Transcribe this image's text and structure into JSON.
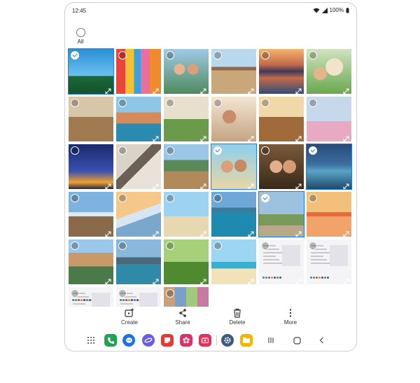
{
  "status": {
    "time": "12:45",
    "battery": "100%"
  },
  "select_all": {
    "label": "All"
  },
  "photos": [
    {
      "sel": true,
      "expand": true,
      "scene": "palm-trees-blue-sky"
    },
    {
      "sel": false,
      "expand": true,
      "scene": "colorful-harbor-houses"
    },
    {
      "sel": false,
      "expand": true,
      "scene": "friends-selfie"
    },
    {
      "sel": false,
      "expand": true,
      "scene": "balcony-view"
    },
    {
      "sel": false,
      "expand": true,
      "scene": "mountain-lake-reflection"
    },
    {
      "sel": false,
      "expand": true,
      "scene": "girl-with-dog"
    },
    {
      "sel": false,
      "expand": false,
      "scene": "group-dinner"
    },
    {
      "sel": false,
      "expand": true,
      "scene": "coastal-village"
    },
    {
      "sel": false,
      "expand": true,
      "scene": "picnic-friends"
    },
    {
      "sel": false,
      "expand": true,
      "scene": "couple-drinks"
    },
    {
      "sel": false,
      "expand": true,
      "scene": "outdoor-dinner"
    },
    {
      "sel": false,
      "expand": true,
      "scene": "japanese-castle"
    },
    {
      "sel": false,
      "expand": true,
      "scene": "eiffel-tower-night"
    },
    {
      "sel": false,
      "expand": true,
      "scene": "rocky-river"
    },
    {
      "sel": false,
      "expand": true,
      "scene": "family-mountain-deck"
    },
    {
      "sel": true,
      "expand": true,
      "scene": "beach-selfie"
    },
    {
      "sel": false,
      "expand": true,
      "scene": "two-girls-selfie"
    },
    {
      "sel": true,
      "expand": true,
      "scene": "kayak-sunset"
    },
    {
      "sel": false,
      "expand": true,
      "scene": "mountain-road"
    },
    {
      "sel": false,
      "expand": true,
      "scene": "airplane-wing"
    },
    {
      "sel": false,
      "expand": true,
      "scene": "father-child-beach"
    },
    {
      "sel": false,
      "expand": true,
      "scene": "kayaks-lake"
    },
    {
      "sel": true,
      "expand": true,
      "scene": "friends-bikes"
    },
    {
      "sel": false,
      "expand": true,
      "scene": "torii-gate-sea"
    },
    {
      "sel": false,
      "expand": true,
      "scene": "cliff-town"
    },
    {
      "sel": false,
      "expand": true,
      "scene": "lake-rocks"
    },
    {
      "sel": false,
      "expand": true,
      "scene": "grass-hammock"
    },
    {
      "sel": false,
      "expand": true,
      "scene": "beach-umbrellas"
    },
    {
      "sel": false,
      "expand": true,
      "scene": "screenshot-settings"
    },
    {
      "sel": false,
      "expand": true,
      "scene": "screenshot-settings-2"
    },
    {
      "sel": false,
      "expand": false,
      "scene": "screenshot-app"
    },
    {
      "sel": false,
      "expand": false,
      "scene": "screenshot-app-2"
    },
    {
      "sel": false,
      "expand": false,
      "scene": "screenshot-gallery"
    }
  ],
  "actions": [
    {
      "label": "Create",
      "icon": "create-icon"
    },
    {
      "label": "Share",
      "icon": "share-icon"
    },
    {
      "label": "Delete",
      "icon": "trash-icon"
    },
    {
      "label": "More",
      "icon": "more-vertical-icon"
    }
  ],
  "navbar": {
    "apps": [
      {
        "name": "apps-grid-icon"
      },
      {
        "name": "phone-app-icon",
        "color": "#1fa355"
      },
      {
        "name": "messages-app-icon",
        "color": "#1f6fe5"
      },
      {
        "name": "internet-app-icon",
        "color": "#6b5ce7"
      },
      {
        "name": "notes-app-icon",
        "color": "#e53935"
      },
      {
        "name": "gallery-app-icon",
        "color": "#e0306b"
      },
      {
        "name": "screen-recorder-app-icon",
        "color": "#e5305a"
      },
      {
        "name": "settings-app-icon",
        "color": "#3d5a80"
      },
      {
        "name": "my-files-app-icon",
        "color": "#f5b400"
      }
    ],
    "buttons": [
      "recents-icon",
      "home-icon",
      "back-icon"
    ]
  },
  "colors": {
    "accent": "#1e7ae6"
  }
}
